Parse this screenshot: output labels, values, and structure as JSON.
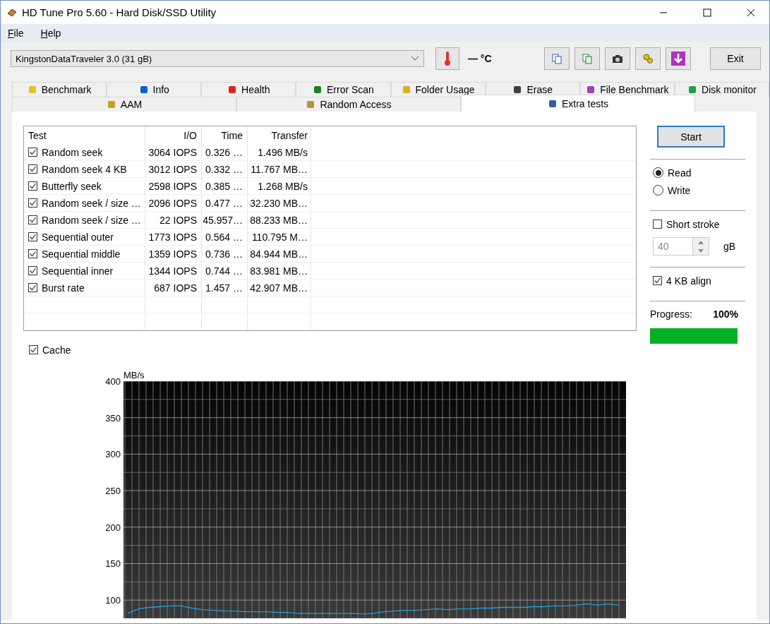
{
  "window": {
    "title": "HD Tune Pro 5.60 - Hard Disk/SSD Utility"
  },
  "menu": [
    "File",
    "Help"
  ],
  "toolbar": {
    "drive": "KingstonDataTraveler 3.0 (31 gB)",
    "temperature": "— °C",
    "exit": "Exit"
  },
  "tab_rows": [
    [
      {
        "label": "Benchmark",
        "selected": false
      },
      {
        "label": "Info",
        "selected": false
      },
      {
        "label": "Health",
        "selected": false
      },
      {
        "label": "Error Scan",
        "selected": false
      },
      {
        "label": "Folder Usage",
        "selected": false
      },
      {
        "label": "Erase",
        "selected": false
      },
      {
        "label": "File Benchmark",
        "selected": false
      },
      {
        "label": "Disk monitor",
        "selected": false
      }
    ],
    [
      {
        "label": "AAM",
        "selected": false
      },
      {
        "label": "Random Access",
        "selected": false
      },
      {
        "label": "Extra tests",
        "selected": true
      }
    ]
  ],
  "table": {
    "columns": [
      "Test",
      "I/O",
      "Time",
      "Transfer"
    ],
    "rows": [
      {
        "checked": true,
        "test": "Random seek",
        "io": "3064 IOPS",
        "time": "0.326 …",
        "transfer": "1.496 MB/s"
      },
      {
        "checked": true,
        "test": "Random seek 4 KB",
        "io": "3012 IOPS",
        "time": "0.332 …",
        "transfer": "11.767 MB…"
      },
      {
        "checked": true,
        "test": "Butterfly seek",
        "io": "2598 IOPS",
        "time": "0.385 …",
        "transfer": "1.268 MB/s"
      },
      {
        "checked": true,
        "test": "Random seek / size …",
        "io": "2096 IOPS",
        "time": "0.477 …",
        "transfer": "32.230 MB…"
      },
      {
        "checked": true,
        "test": "Random seek / size …",
        "io": "22 IOPS",
        "time": "45.957…",
        "transfer": "88.233 MB…"
      },
      {
        "checked": true,
        "test": "Sequential outer",
        "io": "1773 IOPS",
        "time": "0.564 …",
        "transfer": "110.795 M…"
      },
      {
        "checked": true,
        "test": "Sequential middle",
        "io": "1359 IOPS",
        "time": "0.736 …",
        "transfer": "84.944 MB…"
      },
      {
        "checked": true,
        "test": "Sequential inner",
        "io": "1344 IOPS",
        "time": "0.744 …",
        "transfer": "83.981 MB…"
      },
      {
        "checked": true,
        "test": "Burst rate",
        "io": "687 IOPS",
        "time": "1.457 …",
        "transfer": "42.907 MB…"
      }
    ]
  },
  "cache": {
    "label": "Cache",
    "checked": true
  },
  "side": {
    "start": "Start",
    "modes": [
      {
        "label": "Read",
        "selected": true
      },
      {
        "label": "Write",
        "selected": false
      }
    ],
    "short_stroke": {
      "label": "Short stroke",
      "checked": false
    },
    "size": {
      "value": "40",
      "unit": "gB",
      "disabled": true
    },
    "align": {
      "label": "4 KB align",
      "checked": true
    },
    "progress": {
      "label": "Progress:",
      "value": "100%",
      "level": 1
    }
  },
  "chart": {
    "chart_data": {
      "type": "line",
      "grid": true,
      "ylabel": "MB/s",
      "ylim": [
        75,
        400
      ],
      "yticks": [
        100,
        150,
        200,
        250,
        300,
        350,
        400
      ],
      "series": [
        {
          "color": "#1e9fd8",
          "values": [
            82,
            88,
            90,
            91,
            92,
            92,
            89,
            87,
            86,
            85,
            85,
            84,
            84,
            84,
            83,
            83,
            82,
            82,
            82,
            82,
            82,
            82,
            81,
            82,
            84,
            85,
            86,
            86,
            87,
            88,
            87,
            88,
            88,
            89,
            89,
            90,
            90,
            90,
            91,
            91,
            92,
            92,
            93,
            95,
            93,
            95,
            93
          ]
        }
      ]
    }
  }
}
